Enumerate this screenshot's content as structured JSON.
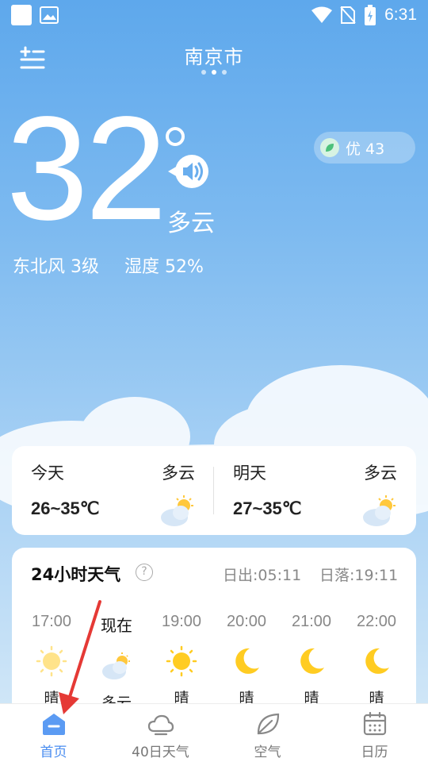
{
  "status_bar": {
    "time": "6:31"
  },
  "header": {
    "city": "南京市",
    "page_dots": 3,
    "active_dot": 1
  },
  "current": {
    "temperature": "32",
    "condition": "多云",
    "aqi_label": "优 43",
    "wind": "东北风 3级",
    "humidity": "湿度 52%"
  },
  "days": [
    {
      "name": "今天",
      "condition": "多云",
      "range": "26~35℃",
      "icon": "partly-cloudy-icon"
    },
    {
      "name": "明天",
      "condition": "多云",
      "range": "27~35℃",
      "icon": "partly-cloudy-icon"
    }
  ],
  "hourly": {
    "title": "24小时天气",
    "sunrise": "日出:05:11",
    "sunset": "日落:19:11",
    "items": [
      {
        "time": "17:00",
        "condition": "晴",
        "icon": "sun-pale-icon"
      },
      {
        "time": "现在",
        "condition": "多云",
        "icon": "partly-cloudy-icon"
      },
      {
        "time": "19:00",
        "condition": "晴",
        "icon": "sun-icon"
      },
      {
        "time": "20:00",
        "condition": "晴",
        "icon": "moon-icon"
      },
      {
        "time": "21:00",
        "condition": "晴",
        "icon": "moon-icon"
      },
      {
        "time": "22:00",
        "condition": "晴",
        "icon": "moon-icon"
      }
    ]
  },
  "tabs": [
    {
      "label": "首页",
      "icon": "home-icon",
      "active": true
    },
    {
      "label": "40日天气",
      "icon": "cloud-icon",
      "active": false
    },
    {
      "label": "空气",
      "icon": "leaf-icon",
      "active": false
    },
    {
      "label": "日历",
      "icon": "calendar-icon",
      "active": false
    }
  ],
  "colors": {
    "accent": "#4a8df0",
    "arrow": "#e53935",
    "sky": "#6fb2ef"
  }
}
